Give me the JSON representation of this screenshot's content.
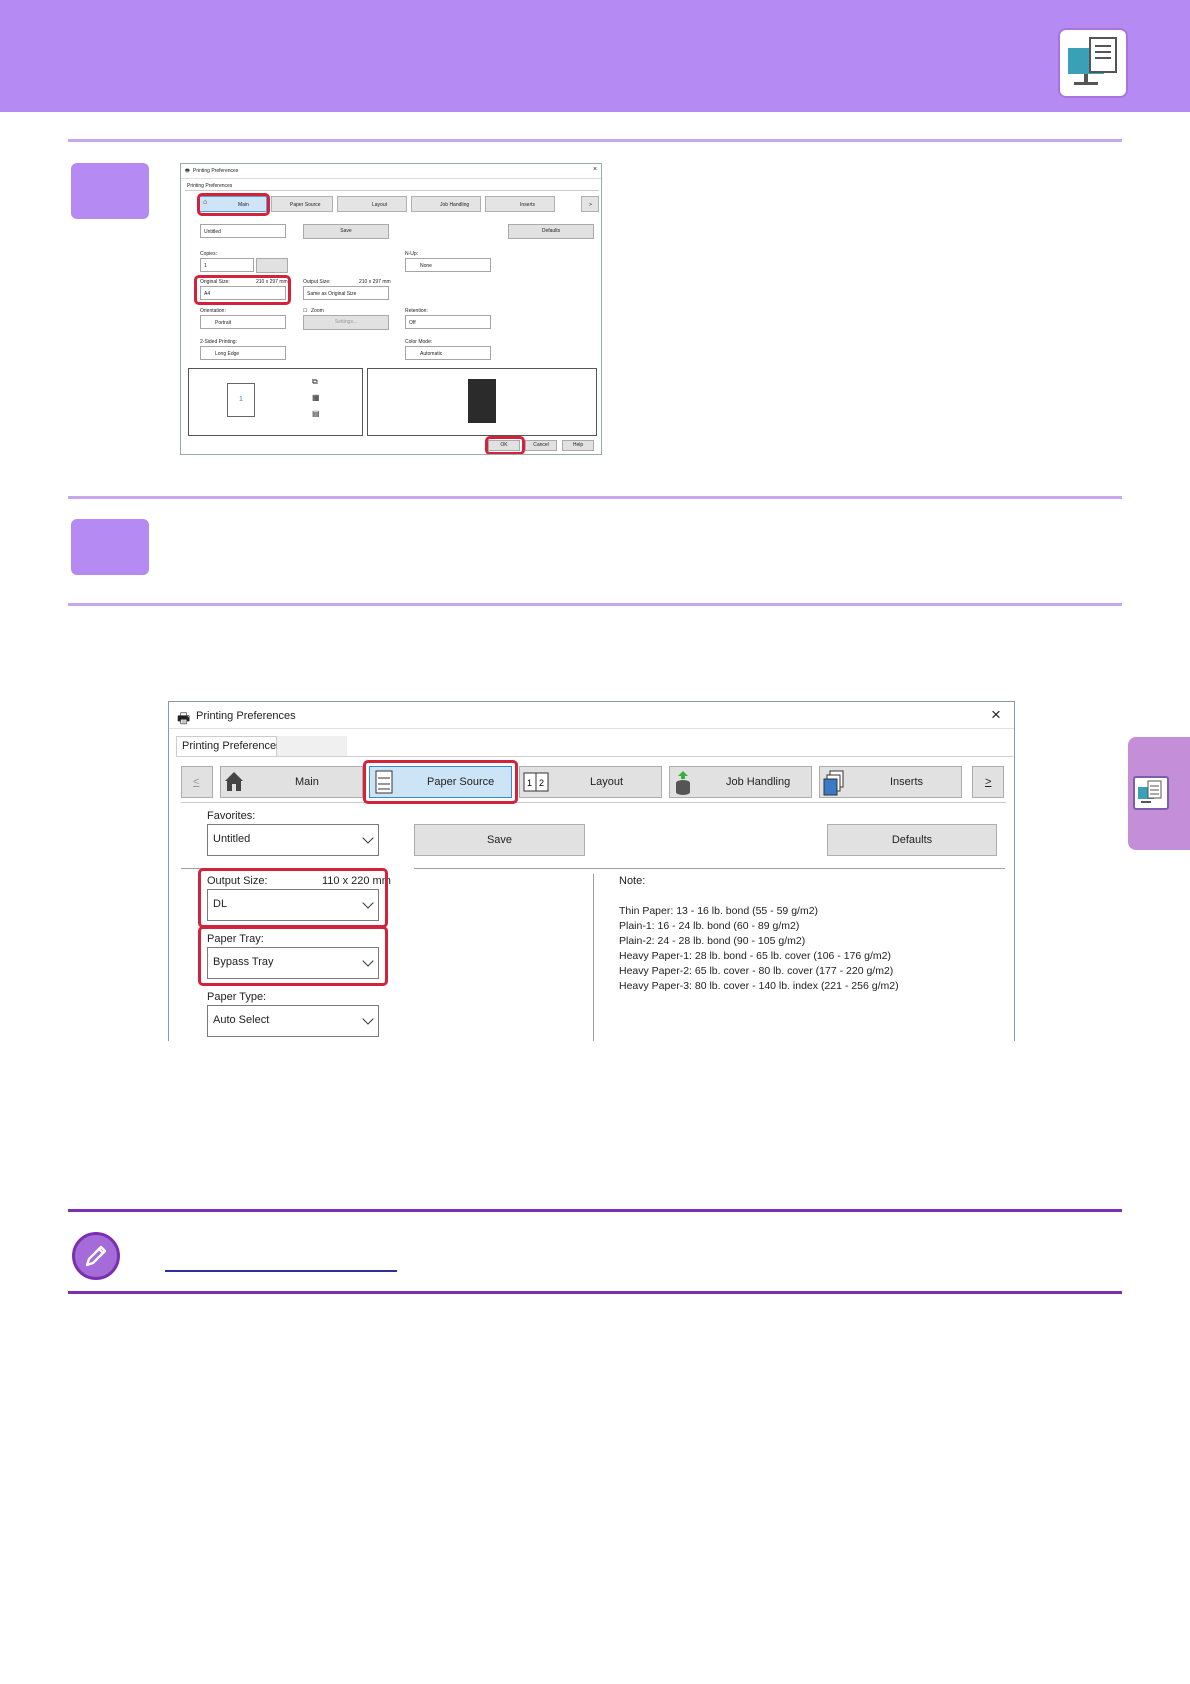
{
  "colors": {
    "header": "#b58af2",
    "step_box": "#b58af2",
    "rule_light": "#c6a6ee",
    "rule_dark": "#7b2fb3",
    "highlight_red": "#d3223c"
  },
  "icons": {
    "header": "computer-document-icon",
    "side_tab": "computer-document-icon",
    "note": "pencil-icon"
  },
  "small_dialog": {
    "title": "Printing Preferences",
    "close": "×",
    "subtab": "Printing Preferences",
    "tabs": [
      "Main",
      "Paper Source",
      "Layout",
      "Job Handling",
      "Inserts",
      ">"
    ],
    "favorites_value": "Untitled",
    "save": "Save",
    "defaults": "Defaults",
    "copies_label": "Copies:",
    "copies_value": "1",
    "original_size_label": "Original Size:",
    "original_size_dim": "210 x 297 mm",
    "original_size_value": "A4",
    "output_size_label": "Output Size:",
    "output_size_dim": "210 x 297 mm",
    "output_size_value": "Same as Original Size",
    "orientation_label": "Orientation:",
    "orientation_value": "Portrait",
    "zoom_label": "Zoom",
    "settings": "Settings...",
    "two_sided_label": "2-Sided Printing:",
    "two_sided_value": "Long Edge",
    "nup_label": "N-Up:",
    "nup_value": "None",
    "retention_label": "Retention:",
    "retention_value": "Off",
    "color_mode_label": "Color Mode:",
    "color_mode_value": "Automatic",
    "preview_page": "1",
    "ok": "OK",
    "cancel": "Cancel",
    "help": "Help"
  },
  "big_dialog": {
    "title": "Printing Preferences",
    "close": "×",
    "subtab": "Printing Preferences",
    "nav_prev": "<",
    "nav_next": ">",
    "tabs": [
      "Main",
      "Paper Source",
      "Layout",
      "Job Handling",
      "Inserts"
    ],
    "favorites_label": "Favorites:",
    "favorites_value": "Untitled",
    "save": "Save",
    "defaults": "Defaults",
    "output_size_label": "Output Size:",
    "output_size_dim": "110 x 220 mm",
    "output_size_value": "DL",
    "paper_tray_label": "Paper Tray:",
    "paper_tray_value": "Bypass Tray",
    "paper_type_label": "Paper Type:",
    "paper_type_value": "Auto Select",
    "note_heading": "Note:",
    "note_lines": [
      "Thin Paper: 13 - 16 lb. bond (55 - 59 g/m2)",
      "Plain-1: 16 - 24 lb. bond (60 - 89 g/m2)",
      "Plain-2: 24 - 28 lb. bond (90 - 105 g/m2)",
      "Heavy Paper-1: 28 lb. bond - 65 lb. cover (106 - 176 g/m2)",
      "Heavy Paper-2: 65 lb. cover - 80 lb. cover (177 - 220 g/m2)",
      "Heavy Paper-3: 80 lb. cover - 140 lb. index (221 - 256 g/m2)"
    ]
  }
}
